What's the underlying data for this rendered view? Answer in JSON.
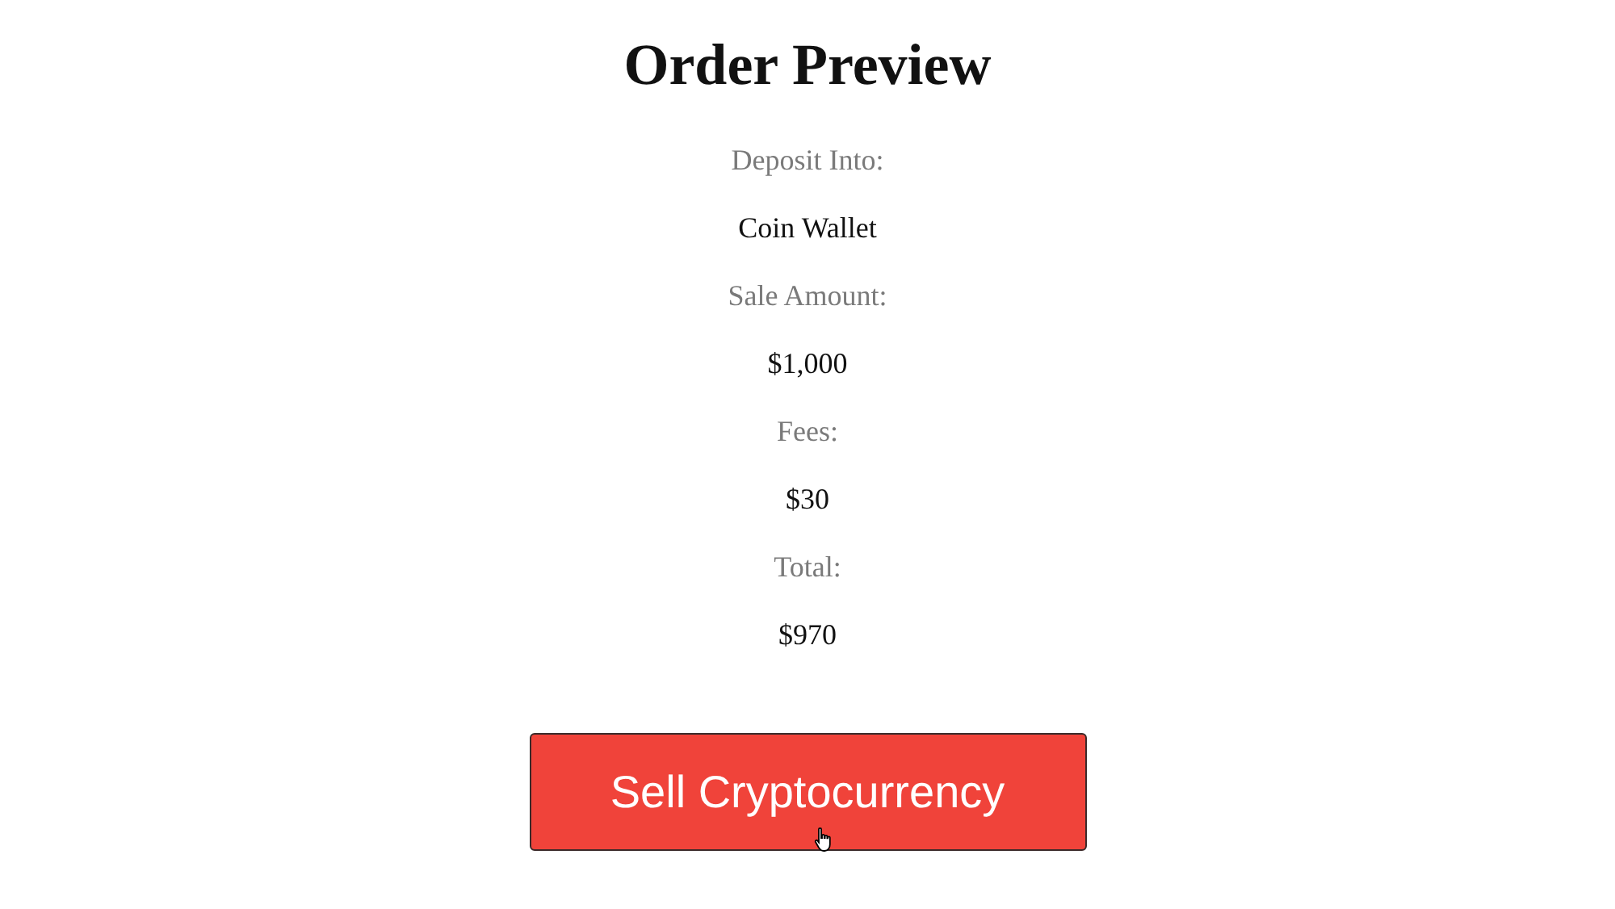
{
  "title": "Order Preview",
  "fields": [
    {
      "label": "Deposit Into:",
      "value": "Coin Wallet"
    },
    {
      "label": "Sale Amount:",
      "value": "$1,000"
    },
    {
      "label": "Fees:",
      "value": "$30"
    },
    {
      "label": "Total:",
      "value": "$970"
    }
  ],
  "button": {
    "label": "Sell Cryptocurrency"
  }
}
